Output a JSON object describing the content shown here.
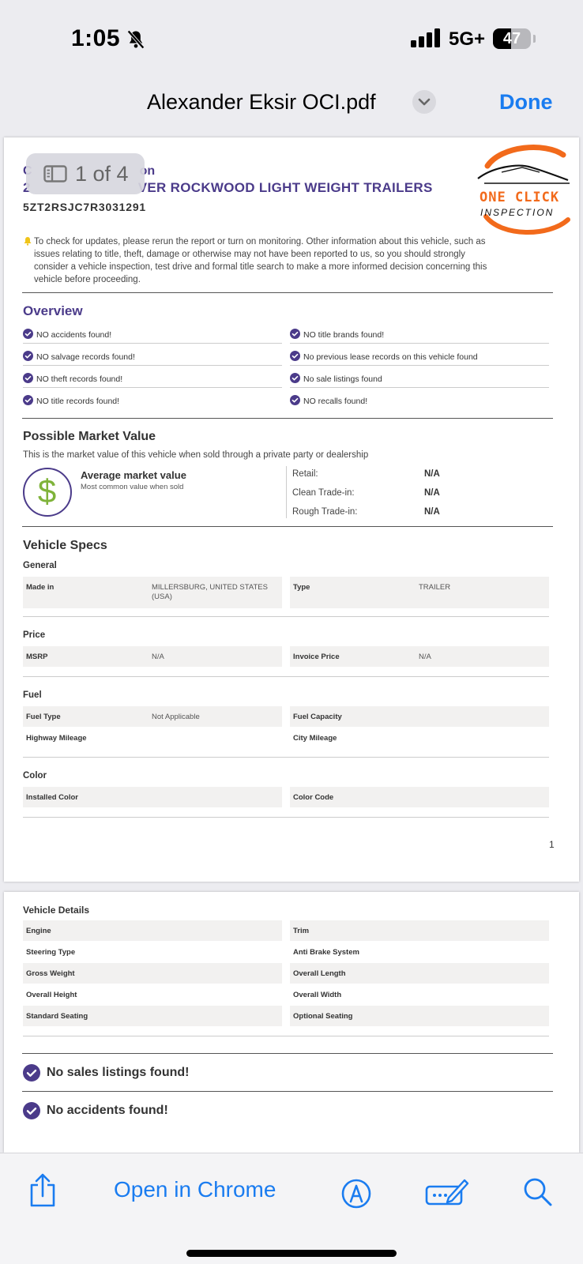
{
  "status_bar": {
    "time": "1:05",
    "network": "5G+",
    "battery": "47"
  },
  "nav": {
    "title": "Alexander Eksir OCI.pdf",
    "done": "Done"
  },
  "page_counter": "1 of 4",
  "report": {
    "subtitle": "C",
    "subtitle_end": "on",
    "title_start": "2",
    "title_end": "VER ROCKWOOD LIGHT WEIGHT TRAILERS",
    "vin": "5ZT2RSJC7R3031291",
    "logo": {
      "line1": "ONE CLICK",
      "line2": "INSPECTION"
    },
    "notice": "To check for updates, please rerun the report or turn on monitoring. Other information about this vehicle, such as issues relating to title, theft, damage or otherwise may not have been reported to us, so you should strongly consider a vehicle inspection, test drive and formal title search to make a more informed decision concerning this vehicle before proceeding."
  },
  "overview": {
    "heading": "Overview",
    "left": [
      "NO accidents found!",
      "NO salvage records found!",
      "NO theft records found!",
      "NO title records found!"
    ],
    "right": [
      "NO title brands found!",
      "No previous lease records on this vehicle found",
      "No sale listings found",
      "NO recalls found!"
    ]
  },
  "market_value": {
    "heading": "Possible Market Value",
    "subtitle": "This is the market value of this vehicle when sold through a private party or dealership",
    "symbol": "$",
    "avg_label": "Average market value",
    "avg_sub": "Most common value when sold",
    "rows": [
      {
        "label": "Retail:",
        "value": "N/A"
      },
      {
        "label": "Clean Trade-in:",
        "value": "N/A"
      },
      {
        "label": "Rough Trade-in:",
        "value": "N/A"
      }
    ]
  },
  "specs": {
    "heading": "Vehicle Specs",
    "general": {
      "label": "General",
      "made_in_k": "Made in",
      "made_in_v": "MILLERSBURG, UNITED STATES (USA)",
      "type_k": "Type",
      "type_v": "TRAILER"
    },
    "price": {
      "label": "Price",
      "msrp_k": "MSRP",
      "msrp_v": "N/A",
      "invoice_k": "Invoice Price",
      "invoice_v": "N/A"
    },
    "fuel": {
      "label": "Fuel",
      "type_k": "Fuel Type",
      "type_v": "Not Applicable",
      "capacity_k": "Fuel Capacity",
      "highway_k": "Highway Mileage",
      "city_k": "City Mileage"
    },
    "color": {
      "label": "Color",
      "installed_k": "Installed Color",
      "code_k": "Color Code"
    }
  },
  "page_number": "1",
  "details": {
    "heading": "Vehicle Details",
    "left": [
      "Engine",
      "Steering Type",
      "Gross Weight",
      "Overall Height",
      "Standard Seating"
    ],
    "right": [
      "Trim",
      "Anti Brake System",
      "Overall Length",
      "Overall Width",
      "Optional Seating"
    ]
  },
  "summary": {
    "sales": "No sales listings found!",
    "accidents": "No accidents found!"
  },
  "toolbar": {
    "open_in": "Open in Chrome"
  },
  "colors": {
    "accent": "#1a7cf0",
    "report_purple": "#4b3b8a",
    "logo_orange": "#f26a1b",
    "dollar_green": "#7fb33a"
  }
}
